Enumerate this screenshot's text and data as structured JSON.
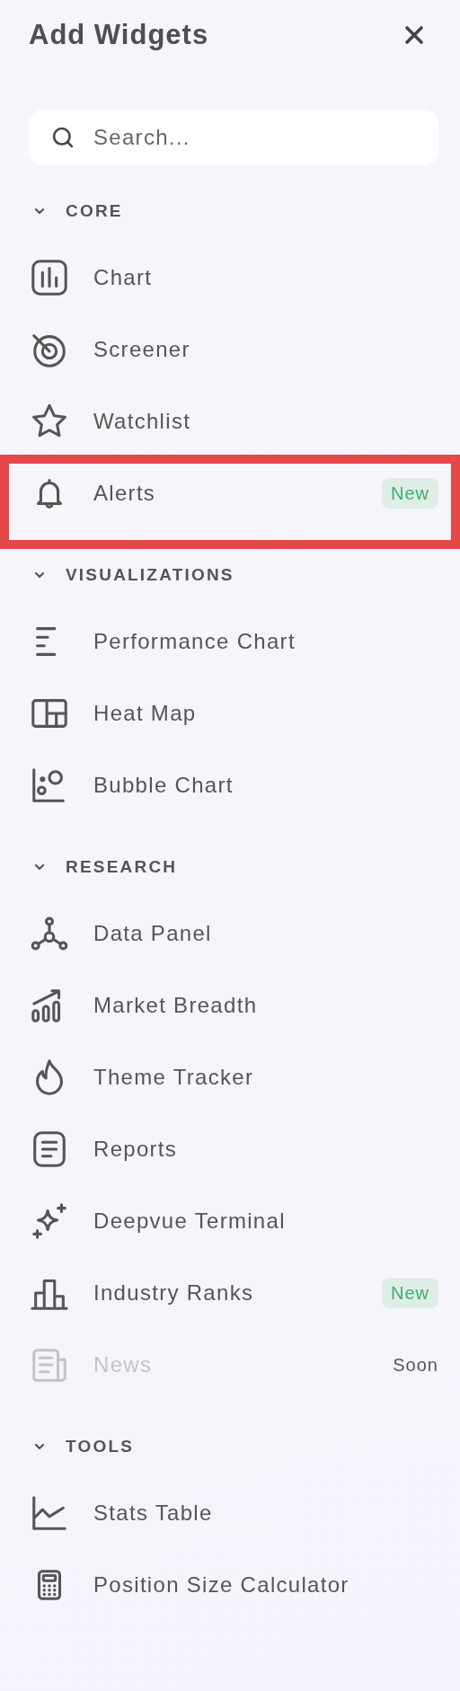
{
  "panel": {
    "title": "Add Widgets"
  },
  "search": {
    "placeholder": "Search..."
  },
  "sections": [
    {
      "label": "CORE",
      "expanded": true,
      "items": [
        {
          "label": "Chart",
          "disabled": false,
          "highlighted": false
        },
        {
          "label": "Screener",
          "disabled": false,
          "highlighted": false
        },
        {
          "label": "Watchlist",
          "disabled": false,
          "highlighted": false
        },
        {
          "label": "Alerts",
          "disabled": false,
          "highlighted": true,
          "badge": "New",
          "kind": "new"
        }
      ]
    },
    {
      "label": "VISUALIZATIONS",
      "expanded": true,
      "items": [
        {
          "label": "Performance Chart",
          "disabled": false,
          "highlighted": false
        },
        {
          "label": "Heat Map",
          "disabled": false,
          "highlighted": false
        },
        {
          "label": "Bubble Chart",
          "disabled": false,
          "highlighted": false
        }
      ]
    },
    {
      "label": "RESEARCH",
      "expanded": true,
      "items": [
        {
          "label": "Data Panel",
          "disabled": false,
          "highlighted": false
        },
        {
          "label": "Market Breadth",
          "disabled": false,
          "highlighted": false
        },
        {
          "label": "Theme Tracker",
          "disabled": false,
          "highlighted": false
        },
        {
          "label": "Reports",
          "disabled": false,
          "highlighted": false
        },
        {
          "label": "Deepvue Terminal",
          "disabled": false,
          "highlighted": false
        },
        {
          "label": "Industry Ranks",
          "disabled": false,
          "highlighted": false,
          "badge": "New",
          "kind": "new"
        },
        {
          "label": "News",
          "disabled": true,
          "highlighted": false,
          "badge": "Soon",
          "kind": "soon"
        }
      ]
    },
    {
      "label": "TOOLS",
      "expanded": true,
      "items": [
        {
          "label": "Stats Table",
          "disabled": false,
          "highlighted": false
        },
        {
          "label": "Position Size Calculator",
          "disabled": false,
          "highlighted": false
        }
      ]
    }
  ]
}
